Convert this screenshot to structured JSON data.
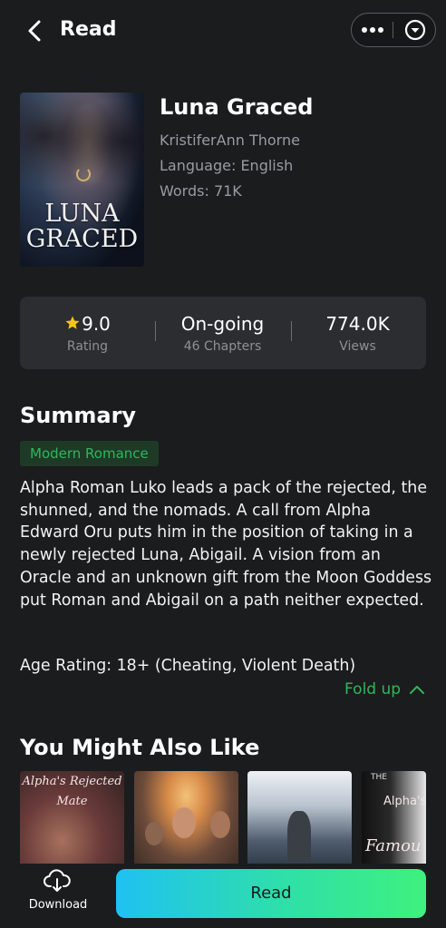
{
  "header": {
    "title": "Read",
    "back_icon": "chevron-left-icon",
    "more_icon": "more-horizontal-icon",
    "menu_icon": "circle-chevron-down-icon"
  },
  "book": {
    "title": "Luna Graced",
    "author": "KristiferAnn Thorne",
    "language": "Language: English",
    "words": "Words: 71K",
    "cover_text_line1": "LUNA",
    "cover_text_line2": "GRACED"
  },
  "stats": {
    "rating_value": "9.0",
    "rating_label": "Rating",
    "status_value": "On-going",
    "status_label": "46 Chapters",
    "views_value": "774.0K",
    "views_label": "Views",
    "star_color": "#f5c518"
  },
  "summary": {
    "heading": "Summary",
    "tag": "Modern Romance",
    "text": "Alpha Roman Luko leads a pack of the rejected, the shunned, and the nomads. A call from Alpha Edward Oru puts him in the position of taking in a newly rejected Luna, Abigail. A vision from an Oracle and an unknown gift from the Moon Goddess put Roman and Abigail on a path neither expected.",
    "age_rating": "Age Rating: 18+ (Cheating, Violent Death)",
    "fold_label": "Fold up"
  },
  "recommendations": {
    "heading": "You Might Also Like",
    "items": [
      {
        "cover_text_1": "Alpha's Rejected",
        "cover_text_2": "Mate"
      },
      {},
      {},
      {
        "cover_text_top": "THE",
        "cover_text_1": "Alpha's",
        "cover_text_2": "Famou"
      }
    ]
  },
  "bottom": {
    "download_label": "Download",
    "read_label": "Read"
  },
  "colors": {
    "accent_green": "#2fb75a",
    "background": "#1b1c1e",
    "card": "#2c2d31"
  }
}
